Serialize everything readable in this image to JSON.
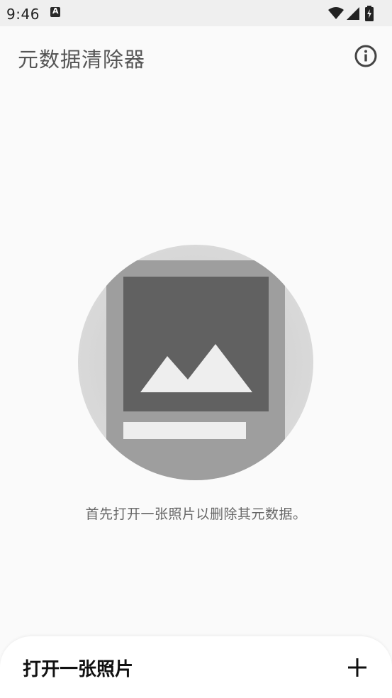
{
  "status_bar": {
    "time": "9:46",
    "notification_icon": "accessibility-a-icon",
    "wifi_icon": "wifi-icon",
    "signal_icon": "cell-signal-icon",
    "battery_icon": "battery-charging-icon"
  },
  "app_bar": {
    "title": "元数据清除器",
    "info_icon": "info-icon"
  },
  "empty_state": {
    "illustration_icon": "image-placeholder-icon",
    "message": "首先打开一张照片以删除其元数据。"
  },
  "bottom_sheet": {
    "label": "打开一张照片",
    "action_icon": "add-icon"
  },
  "colors": {
    "background": "#fafafa",
    "status_bar": "#efefef",
    "title_text": "#555555",
    "illustration_dark": "#616161",
    "illustration_mid": "#9e9e9e",
    "illustration_light": "#eeeeee"
  }
}
